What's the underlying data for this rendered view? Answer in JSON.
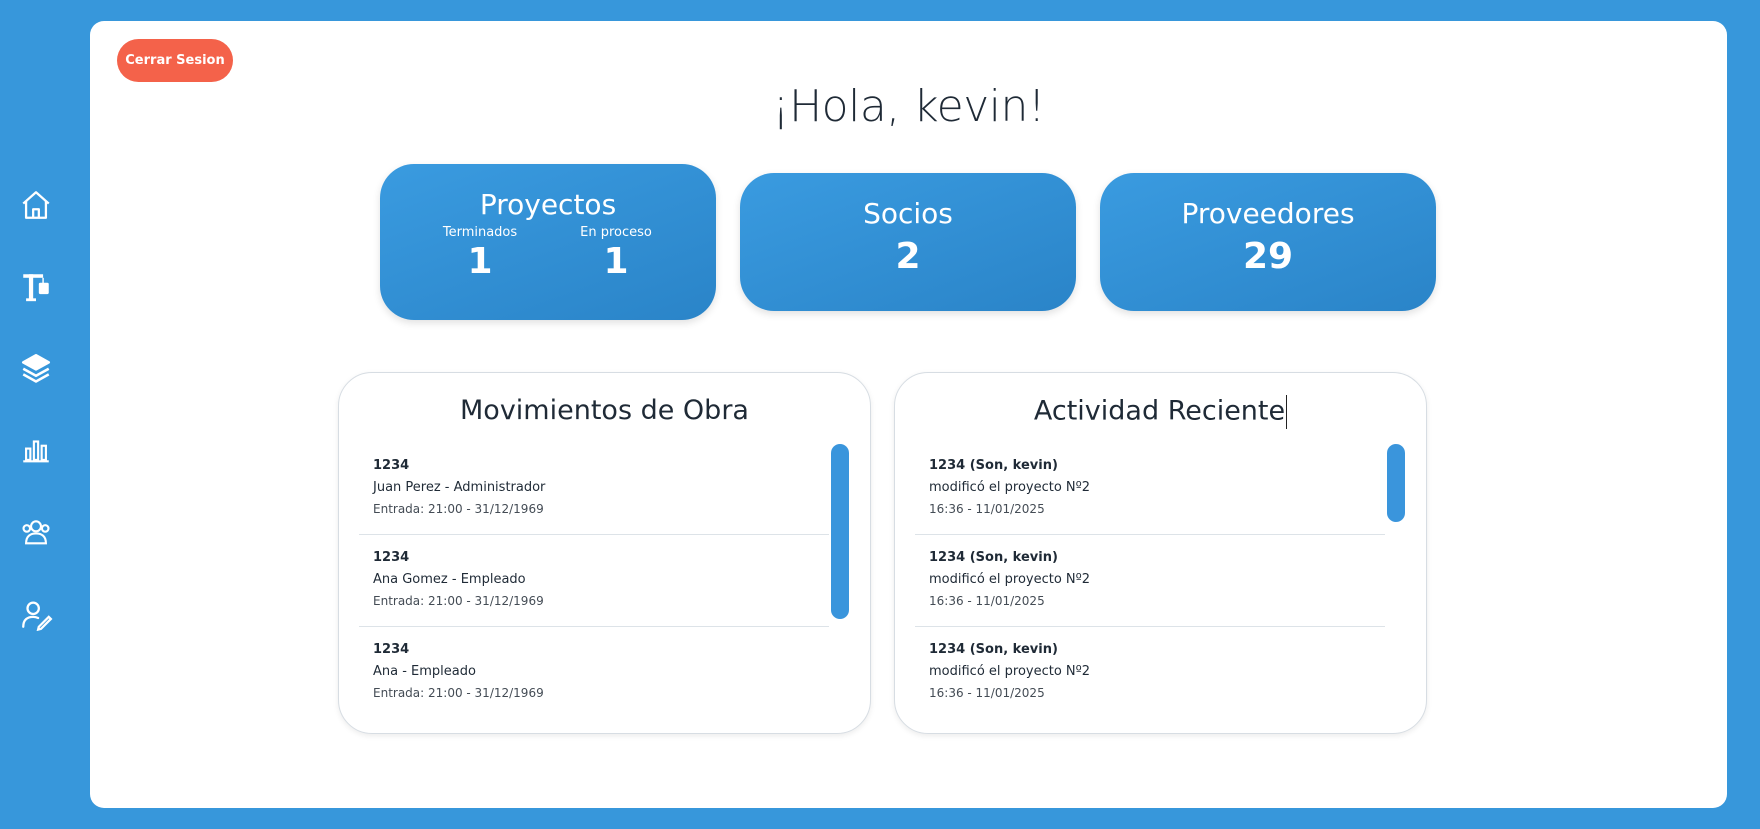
{
  "sidebar": {
    "items": [
      {
        "icon": "home-icon"
      },
      {
        "icon": "crane-icon"
      },
      {
        "icon": "layers-icon"
      },
      {
        "icon": "bar-chart-icon"
      },
      {
        "icon": "users-icon"
      },
      {
        "icon": "user-edit-icon"
      }
    ]
  },
  "header": {
    "logout_label": "Cerrar Sesion",
    "greeting": "¡Hola, kevin!"
  },
  "stats": {
    "projects": {
      "title": "Proyectos",
      "finished_label": "Terminados",
      "finished_value": "1",
      "in_progress_label": "En proceso",
      "in_progress_value": "1"
    },
    "partners": {
      "title": "Socios",
      "value": "2"
    },
    "suppliers": {
      "title": "Proveedores",
      "value": "29"
    }
  },
  "movements": {
    "title": "Movimientos de Obra",
    "items": [
      {
        "id": "1234",
        "desc": "Juan Perez - Administrador",
        "time": "Entrada: 21:00 - 31/12/1969"
      },
      {
        "id": "1234",
        "desc": "Ana Gomez - Empleado",
        "time": "Entrada: 21:00 - 31/12/1969"
      },
      {
        "id": "1234",
        "desc": "Ana - Empleado",
        "time": "Entrada: 21:00 - 31/12/1969"
      }
    ]
  },
  "activity": {
    "title": "Actividad Reciente",
    "items": [
      {
        "id": "1234 (Son, kevin)",
        "desc": "modificó el proyecto Nº2",
        "time": "16:36 - 11/01/2025"
      },
      {
        "id": "1234 (Son, kevin)",
        "desc": "modificó el proyecto Nº2",
        "time": "16:36 - 11/01/2025"
      },
      {
        "id": "1234 (Son, kevin)",
        "desc": "modificó el proyecto Nº2",
        "time": "16:36 - 11/01/2025"
      }
    ]
  },
  "colors": {
    "background": "#3797db",
    "accent": "#2a84c8",
    "logout": "#f4624a"
  }
}
